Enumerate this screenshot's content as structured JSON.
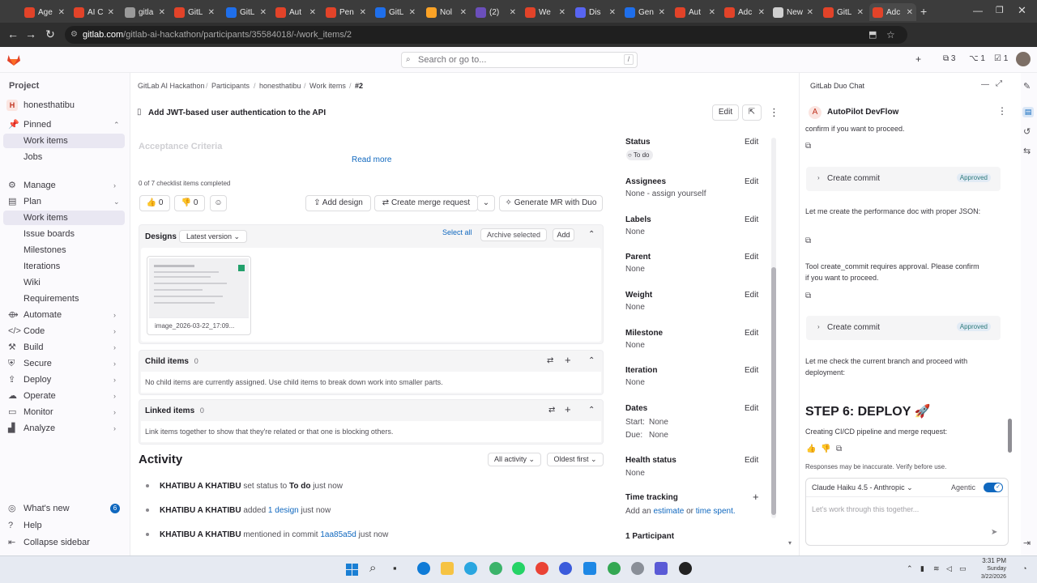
{
  "browser": {
    "tabs": [
      {
        "label": "Age",
        "color": "#e24329"
      },
      {
        "label": "AI C",
        "color": "#e24329"
      },
      {
        "label": "gitla",
        "color": "#9a9a9a"
      },
      {
        "label": "GitL",
        "color": "#e24329"
      },
      {
        "label": "GitL",
        "color": "#1f6feb"
      },
      {
        "label": "Aut",
        "color": "#e24329"
      },
      {
        "label": "Pen",
        "color": "#e24329"
      },
      {
        "label": "GitL",
        "color": "#1f6feb"
      },
      {
        "label": "Nol",
        "color": "#fca326"
      },
      {
        "label": "(2)",
        "color": "#6b4fbb"
      },
      {
        "label": "We",
        "color": "#e24329"
      },
      {
        "label": "Dis",
        "color": "#5865f2"
      },
      {
        "label": "Gen",
        "color": "#1f6feb"
      },
      {
        "label": "Aut",
        "color": "#e24329"
      },
      {
        "label": "Adc",
        "color": "#e24329"
      },
      {
        "label": "New",
        "color": "#cfcfcf"
      },
      {
        "label": "GitL",
        "color": "#e24329"
      },
      {
        "label": "Adc",
        "color": "#e24329"
      }
    ],
    "url_domain": "gitlab.com",
    "url_path": "/gitlab-ai-hackathon/participants/35584018/-/work_items/2"
  },
  "topbar": {
    "search_placeholder": "Search or go to...",
    "search_shortcut": "/",
    "merge_requests_count": "3",
    "issues_count": "1",
    "todos_count": "1"
  },
  "sidebar": {
    "section": "Project",
    "project_initial": "H",
    "project_name": "honesthatibu",
    "pinned": "Pinned",
    "pinned_items": [
      "Work items",
      "Jobs"
    ],
    "manage": "Manage",
    "plan": "Plan",
    "plan_items": [
      "Work items",
      "Issue boards",
      "Milestones",
      "Iterations",
      "Wiki",
      "Requirements"
    ],
    "groups": [
      "Automate",
      "Code",
      "Build",
      "Secure",
      "Deploy",
      "Operate",
      "Monitor",
      "Analyze"
    ],
    "whats_new": "What's new",
    "whats_new_count": "6",
    "help": "Help",
    "collapse": "Collapse sidebar"
  },
  "breadcrumb": [
    "GitLab AI Hackathon",
    "Participants",
    "honesthatibu",
    "Work items",
    "#2"
  ],
  "work_item": {
    "title": "Add JWT-based user authentication to the API",
    "edit": "Edit",
    "faded_heading": "Acceptance Criteria",
    "read_more": "Read more",
    "checklist": "0 of 7 checklist items completed",
    "thumbs_up": "0",
    "thumbs_down": "0",
    "add_design": "Add design",
    "create_mr": "Create merge request",
    "generate_mr": "Generate MR with Duo"
  },
  "designs": {
    "title": "Designs",
    "version": "Latest version",
    "select_all": "Select all",
    "archive": "Archive selected",
    "add": "Add",
    "file": "image_2026-03-22_17:09..."
  },
  "child_items": {
    "title": "Child items",
    "count": "0",
    "empty": "No child items are currently assigned. Use child items to break down work into smaller parts."
  },
  "linked_items": {
    "title": "Linked items",
    "count": "0",
    "empty": "Link items together to show that they're related or that one is blocking others."
  },
  "activity": {
    "title": "Activity",
    "filter": "All activity",
    "sort": "Oldest first",
    "entries": [
      {
        "user": "KHATIBU A KHATIBU",
        "pre": "set status to",
        "bold": "To do",
        "link": "",
        "post": "just now"
      },
      {
        "user": "KHATIBU A KHATIBU",
        "pre": "added",
        "bold": "",
        "link": "1 design",
        "post": "just now"
      },
      {
        "user": "KHATIBU A KHATIBU",
        "pre": "mentioned in commit",
        "bold": "",
        "link": "1aa85a5d",
        "post": "just now"
      }
    ]
  },
  "attributes": {
    "status_label": "Status",
    "status_value": "To do",
    "assignees_label": "Assignees",
    "assignees_value": "None - assign yourself",
    "labels_label": "Labels",
    "labels_value": "None",
    "parent_label": "Parent",
    "parent_value": "None",
    "weight_label": "Weight",
    "weight_value": "None",
    "milestone_label": "Milestone",
    "milestone_value": "None",
    "iteration_label": "Iteration",
    "iteration_value": "None",
    "dates_label": "Dates",
    "start_label": "Start:",
    "start_value": "None",
    "due_label": "Due:",
    "due_value": "None",
    "health_label": "Health status",
    "health_value": "None",
    "time_label": "Time tracking",
    "time_add": "Add an",
    "time_estimate": "estimate",
    "time_or": "or",
    "time_spent": "time spent.",
    "participants": "1 Participant",
    "edit": "Edit"
  },
  "duo": {
    "panel_title": "GitLab Duo Chat",
    "agent_initial": "A",
    "agent_name": "AutoPilot DevFlow",
    "msg_top": "confirm if you want to proceed.",
    "commit_label": "Create commit",
    "approved": "Approved",
    "msg_perf": "Let me create the performance doc with proper JSON:",
    "msg_tool": "Tool create_commit requires approval. Please confirm if you want to proceed.",
    "msg_branch": "Let me check the current branch and proceed with deployment:",
    "step_heading": "STEP 6: DEPLOY 🚀",
    "msg_pipeline": "Creating CI/CD pipeline and merge request:",
    "disclaimer": "Responses may be inaccurate. Verify before use.",
    "model": "Claude Haiku 4.5 - Anthropic",
    "agentic": "Agentic",
    "input_placeholder": "Let's work through this together..."
  },
  "taskbar": {
    "time": "3:31 PM",
    "day": "Sunday",
    "date": "3/22/2026"
  },
  "colors": {
    "accent": "#1068bf",
    "gitlab_orange": "#e24329",
    "approved": "#2c7a7b"
  }
}
